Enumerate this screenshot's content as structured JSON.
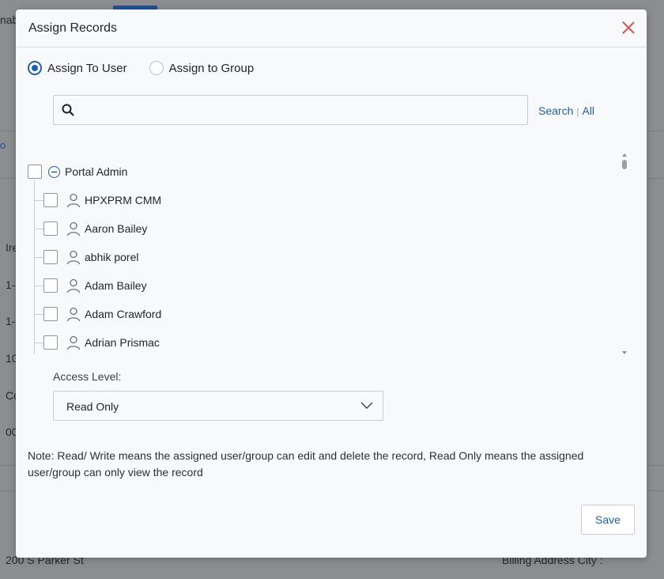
{
  "background": {
    "fragments": [
      "nab",
      "o",
      "Ire",
      "1-",
      "1-",
      "10",
      "Co",
      "00"
    ],
    "bottom_left": "200 S Parker St",
    "bottom_right": "Billing Address City :"
  },
  "modal": {
    "title": "Assign Records",
    "radio": {
      "assign_user": "Assign To User",
      "assign_group": "Assign to Group",
      "selected": "assign_user"
    },
    "search": {
      "placeholder": "",
      "value": "",
      "search_link": "Search",
      "separator": "|",
      "all_link": "All"
    },
    "tree": {
      "root": "Portal Admin",
      "users": [
        "HPXPRM CMM",
        "Aaron Bailey",
        "abhik porel",
        "Adam Bailey",
        "Adam Crawford",
        "Adrian Prismac"
      ]
    },
    "access": {
      "label": "Access Level:",
      "value": "Read Only"
    },
    "note": "Note: Read/ Write means the assigned user/group can edit and delete the record, Read Only means the assigned user/group can only view the record",
    "save_label": "Save"
  },
  "colors": {
    "accent": "#1f5fb0",
    "close": "#d9534f",
    "overlay": "#8c8d8f"
  }
}
